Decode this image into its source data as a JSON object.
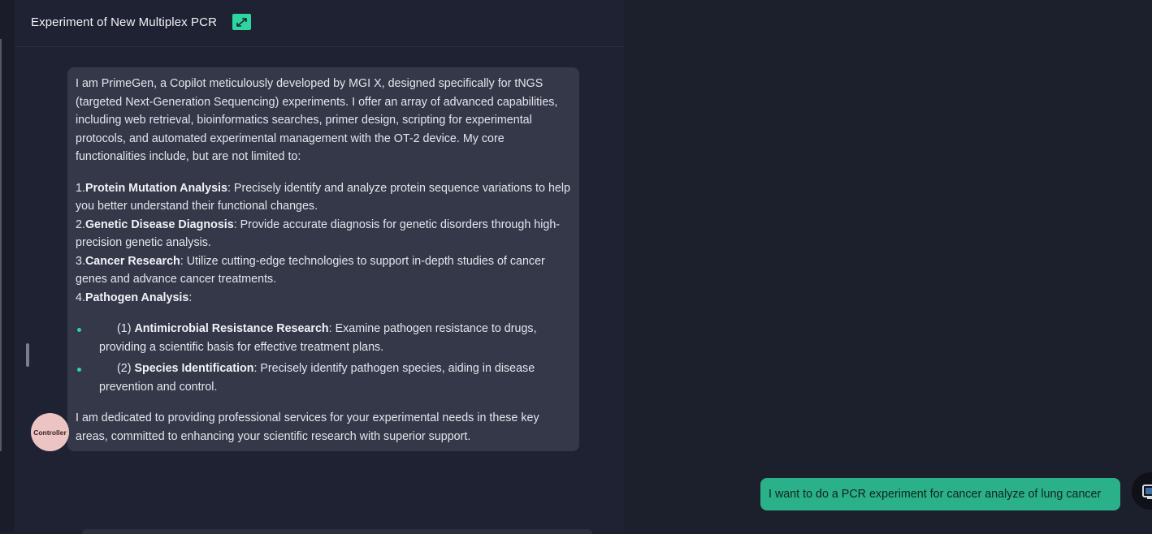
{
  "header": {
    "title": "Experiment of New Multiplex PCR",
    "expand_icon": "expand-arrows-icon"
  },
  "bot_message": {
    "intro": "I am PrimeGen, a Copilot meticulously developed by MGI X, designed specifically for tNGS (targeted Next-Generation Sequencing) experiments. I offer an array of advanced capabilities, including web retrieval, bioinformatics searches, primer design, scripting for experimental protocols, and automated experimental management with the OT-2 device. My core functionalities include, but are not limited to:",
    "capabilities": [
      {
        "num": "1.",
        "title": "Protein Mutation Analysis",
        "desc": ": Precisely identify and analyze protein sequence variations to help you better understand their functional changes."
      },
      {
        "num": "2.",
        "title": "Genetic Disease Diagnosis",
        "desc": ": Provide accurate diagnosis for genetic disorders through high-precision genetic analysis."
      },
      {
        "num": "3.",
        "title": "Cancer Research",
        "desc": ": Utilize cutting-edge technologies to support in-depth studies of cancer genes and advance cancer treatments."
      },
      {
        "num": "4.",
        "title": "Pathogen Analysis",
        "desc": ":"
      }
    ],
    "sub_items": [
      {
        "num": "(1) ",
        "title": "Antimicrobial Resistance Research",
        "desc": ": Examine pathogen resistance to drugs, providing a scientific basis for effective treatment plans."
      },
      {
        "num": "(2) ",
        "title": "Species Identification",
        "desc": ": Precisely identify pathogen species, aiding in disease prevention and control."
      }
    ],
    "closing": "I am dedicated to providing professional services for your experimental needs in these key areas, committed to enhancing your scientific research with superior support.",
    "avatar_label": "Controller"
  },
  "user_message": {
    "text": "I want to do a PCR experiment for cancer analyze of lung cancer",
    "avatar_icon": "user-avatar-icon"
  },
  "colors": {
    "accent": "#2dd6a0",
    "user_bubble": "#2bb189",
    "bot_bubble": "#353849",
    "background": "#1c1f2c"
  }
}
